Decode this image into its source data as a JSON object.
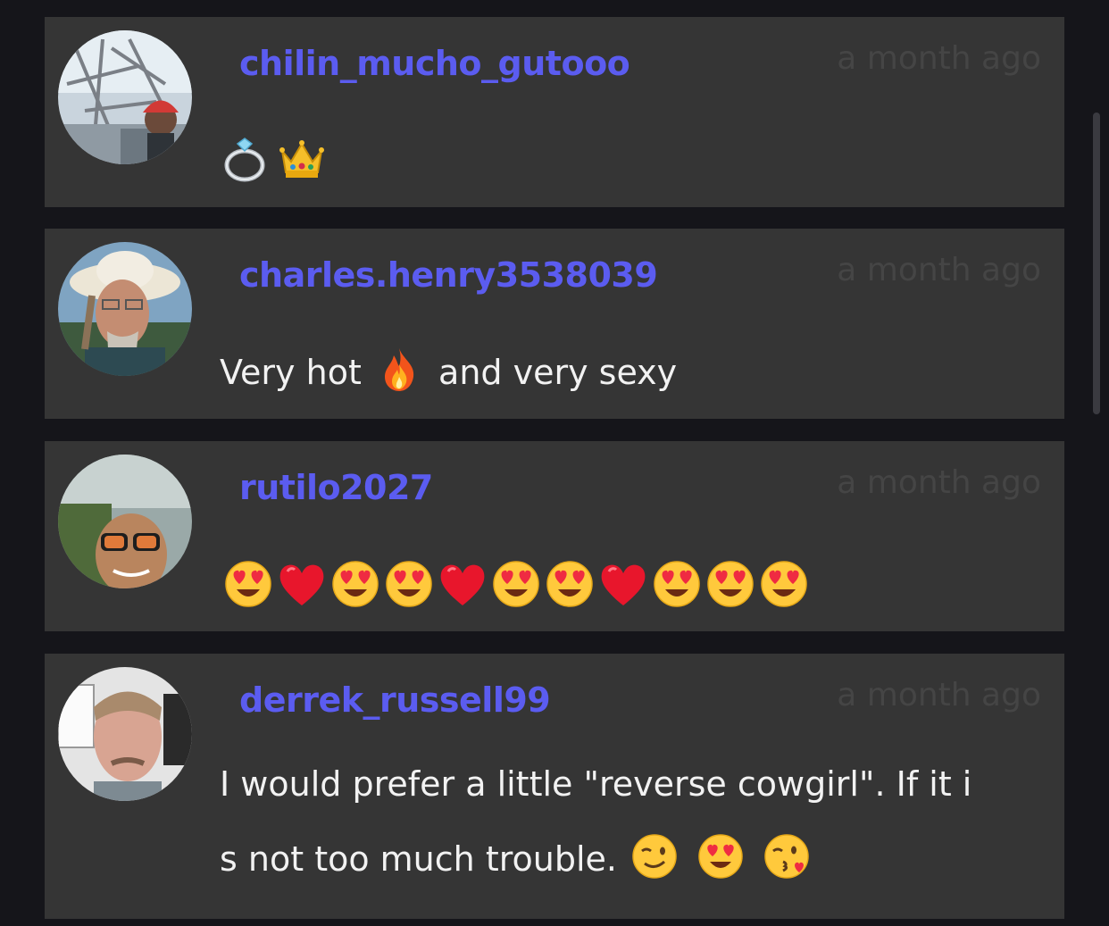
{
  "comments": [
    {
      "username": "chilin_mucho_gutooo",
      "timestamp": "a month ago",
      "text": "",
      "emojis": [
        "ring-emoji",
        "crown-emoji"
      ]
    },
    {
      "username": "charles.henry3538039",
      "timestamp": "a month ago",
      "text_before": "Very hot",
      "text_after": "and very sexy",
      "emojis": [
        "fire-emoji"
      ]
    },
    {
      "username": "rutilo2027",
      "timestamp": "a month ago",
      "text": "",
      "emojis": [
        "heart-eyes-emoji",
        "red-heart-emoji",
        "heart-eyes-emoji",
        "heart-eyes-emoji",
        "red-heart-emoji",
        "heart-eyes-emoji",
        "heart-eyes-emoji",
        "red-heart-emoji",
        "heart-eyes-emoji",
        "heart-eyes-emoji",
        "heart-eyes-emoji"
      ]
    },
    {
      "username": "derrek_russell99",
      "timestamp": "a month ago",
      "line1": "I would prefer a little \"reverse cowgirl\". If it i",
      "line2": "s not too much trouble.",
      "emojis": [
        "winking-face-emoji",
        "heart-eyes-emoji",
        "face-blowing-kiss-emoji"
      ]
    }
  ],
  "colors": {
    "background": "#15151a",
    "card": "#353535",
    "username": "#5b5cf0",
    "timestamp": "#454545",
    "text": "#f2f2f2"
  }
}
